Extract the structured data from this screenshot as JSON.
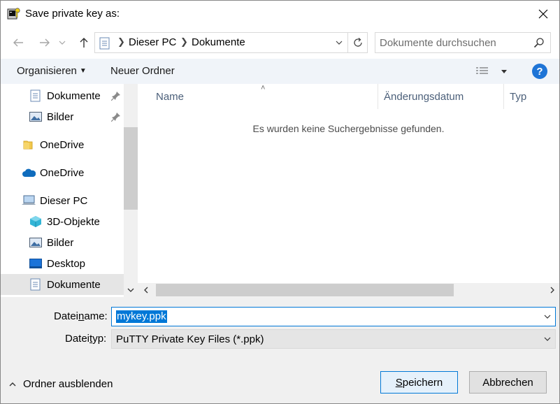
{
  "window": {
    "title": "Save private key as:"
  },
  "address": {
    "segments": [
      "Dieser PC",
      "Dokumente"
    ]
  },
  "search": {
    "placeholder": "Dokumente durchsuchen"
  },
  "toolbar": {
    "organize_label": "Organisieren",
    "new_folder_label": "Neuer Ordner",
    "help_label": "?"
  },
  "nav": {
    "items": [
      {
        "label": "Dokumente",
        "icon": "documents-icon",
        "pinned": true
      },
      {
        "label": "Bilder",
        "icon": "pictures-icon",
        "pinned": true
      },
      {
        "label": "OneDrive",
        "icon": "folder-icon",
        "pinned": false
      },
      {
        "label": "OneDrive",
        "icon": "onedrive-cloud-icon",
        "pinned": false
      },
      {
        "label": "Dieser PC",
        "icon": "computer-icon",
        "pinned": false
      },
      {
        "label": "3D-Objekte",
        "icon": "3d-objects-icon",
        "pinned": false
      },
      {
        "label": "Bilder",
        "icon": "pictures-icon",
        "pinned": false
      },
      {
        "label": "Desktop",
        "icon": "desktop-icon",
        "pinned": false
      },
      {
        "label": "Dokumente",
        "icon": "documents-icon",
        "pinned": false,
        "selected": true
      }
    ]
  },
  "filelist": {
    "columns": [
      "Name",
      "Änderungsdatum",
      "Typ"
    ],
    "empty_message": "Es wurden keine Suchergebnisse gefunden."
  },
  "form": {
    "filename_label_pre": "Datei",
    "filename_label_u": "n",
    "filename_label_post": "ame:",
    "filename_value": "mykey.ppk",
    "filetype_label_pre": "Datei",
    "filetype_label_u": "t",
    "filetype_label_post": "yp:",
    "filetype_value": "PuTTY Private Key Files (*.ppk)"
  },
  "footer": {
    "toggle_label": "Ordner ausblenden",
    "save_u": "S",
    "save_rest": "peichern",
    "cancel_label": "Abbrechen"
  },
  "colors": {
    "accent": "#0078d7",
    "selected_bg": "#e5e5e5",
    "cmdbar_bg": "#f0f4f9",
    "help": "#1e74d6"
  }
}
